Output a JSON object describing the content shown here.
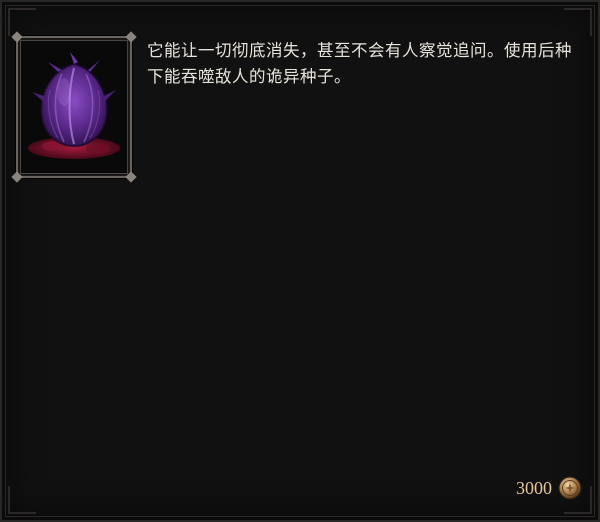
{
  "item": {
    "icon": "purple-seed-icon",
    "description": "它能让一切彻底消失，甚至不会有人察觉追问。使用后种下能吞噬敌人的诡异种子。",
    "price": "3000",
    "currency_icon": "gold-coin-icon"
  },
  "colors": {
    "background": "#121111",
    "text": "#e8e4dc",
    "price": "#e6c79a",
    "seed": "#5b2a8c",
    "flesh": "#7a1230"
  }
}
